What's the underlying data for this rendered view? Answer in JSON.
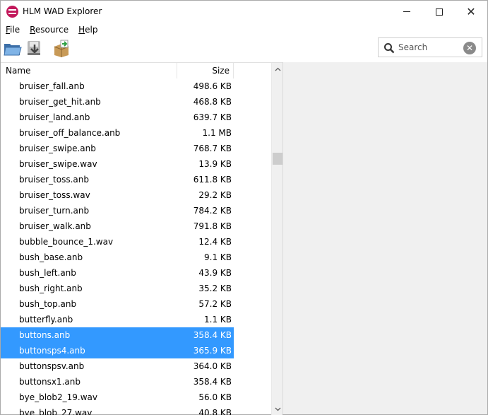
{
  "window": {
    "title": "HLM WAD Explorer",
    "accent": "#c2185b",
    "selection_color": "#3399ff"
  },
  "menu": {
    "file": {
      "accel": "F",
      "rest": "ile"
    },
    "resource": {
      "accel": "R",
      "rest": "esource"
    },
    "help": {
      "accel": "H",
      "rest": "elp"
    }
  },
  "toolbar": {
    "icons": [
      "open-folder-icon",
      "save-icon",
      "export-icon"
    ]
  },
  "search": {
    "placeholder": "Search",
    "value": ""
  },
  "list": {
    "columns": {
      "name": "Name",
      "size": "Size"
    },
    "rows": [
      {
        "name": "bruiser_fall.anb",
        "size": "498.6 KB",
        "selected": false
      },
      {
        "name": "bruiser_get_hit.anb",
        "size": "468.8 KB",
        "selected": false
      },
      {
        "name": "bruiser_land.anb",
        "size": "639.7 KB",
        "selected": false
      },
      {
        "name": "bruiser_off_balance.anb",
        "size": "1.1 MB",
        "selected": false
      },
      {
        "name": "bruiser_swipe.anb",
        "size": "768.7 KB",
        "selected": false
      },
      {
        "name": "bruiser_swipe.wav",
        "size": "13.9 KB",
        "selected": false
      },
      {
        "name": "bruiser_toss.anb",
        "size": "611.8 KB",
        "selected": false
      },
      {
        "name": "bruiser_toss.wav",
        "size": "29.2 KB",
        "selected": false
      },
      {
        "name": "bruiser_turn.anb",
        "size": "784.2 KB",
        "selected": false
      },
      {
        "name": "bruiser_walk.anb",
        "size": "791.8 KB",
        "selected": false
      },
      {
        "name": "bubble_bounce_1.wav",
        "size": "12.4 KB",
        "selected": false
      },
      {
        "name": "bush_base.anb",
        "size": "9.1 KB",
        "selected": false
      },
      {
        "name": "bush_left.anb",
        "size": "43.9 KB",
        "selected": false
      },
      {
        "name": "bush_right.anb",
        "size": "35.2 KB",
        "selected": false
      },
      {
        "name": "bush_top.anb",
        "size": "57.2 KB",
        "selected": false
      },
      {
        "name": "butterfly.anb",
        "size": "1.1 KB",
        "selected": false
      },
      {
        "name": "buttons.anb",
        "size": "358.4 KB",
        "selected": true
      },
      {
        "name": "buttonsps4.anb",
        "size": "365.9 KB",
        "selected": true
      },
      {
        "name": "buttonspsv.anb",
        "size": "364.0 KB",
        "selected": false
      },
      {
        "name": "buttonsx1.anb",
        "size": "358.4 KB",
        "selected": false
      },
      {
        "name": "bye_blob2_19.wav",
        "size": "56.0 KB",
        "selected": false
      },
      {
        "name": "bye_blob_27.wav",
        "size": "40.8 KB",
        "selected": false
      }
    ]
  }
}
